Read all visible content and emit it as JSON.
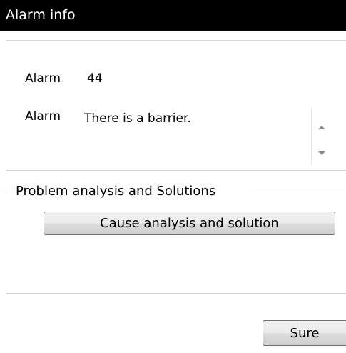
{
  "window": {
    "title": "Alarm info"
  },
  "alarm": {
    "code_label": "Alarm",
    "code_value": "44",
    "message_label": "Alarm",
    "message_value": "There is a barrier."
  },
  "analysis": {
    "group_title": "Problem analysis and Solutions",
    "cause_button_label": "Cause analysis and solution"
  },
  "footer": {
    "sure_button_label": "Sure"
  },
  "icons": {
    "scroll_up": "scroll-up-arrow-icon",
    "scroll_down": "scroll-down-arrow-icon"
  },
  "colors": {
    "titlebar_bg": "#000000",
    "titlebar_text": "#ffffff",
    "divider": "#cfd7e3"
  }
}
